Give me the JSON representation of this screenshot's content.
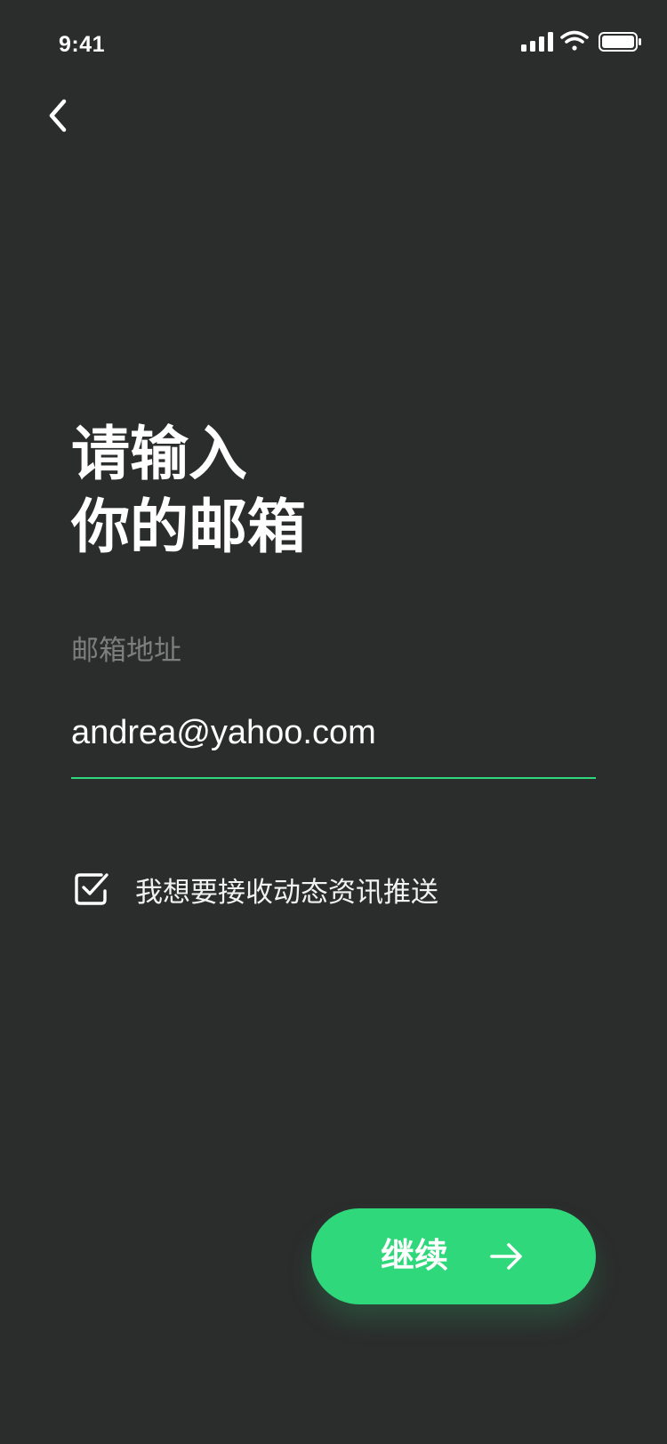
{
  "status_bar": {
    "time": "9:41",
    "signal_icon": "cellular-signal-icon",
    "wifi_icon": "wifi-icon",
    "battery_icon": "battery-icon"
  },
  "nav": {
    "back_icon": "chevron-left-icon"
  },
  "title": {
    "line1": "请输入",
    "line2": "你的邮箱"
  },
  "email_field": {
    "label": "邮箱地址",
    "value": "andrea@yahoo.com"
  },
  "newsletter_checkbox": {
    "checked": true,
    "label": "我想要接收动态资讯推送",
    "icon": "checkbox-checked-icon"
  },
  "continue_button": {
    "label": "继续",
    "icon": "arrow-right-icon"
  },
  "colors": {
    "background": "#2b2c2c",
    "accent": "#2fd87a",
    "label_gray": "#7d7e7e",
    "text": "#ffffff"
  }
}
